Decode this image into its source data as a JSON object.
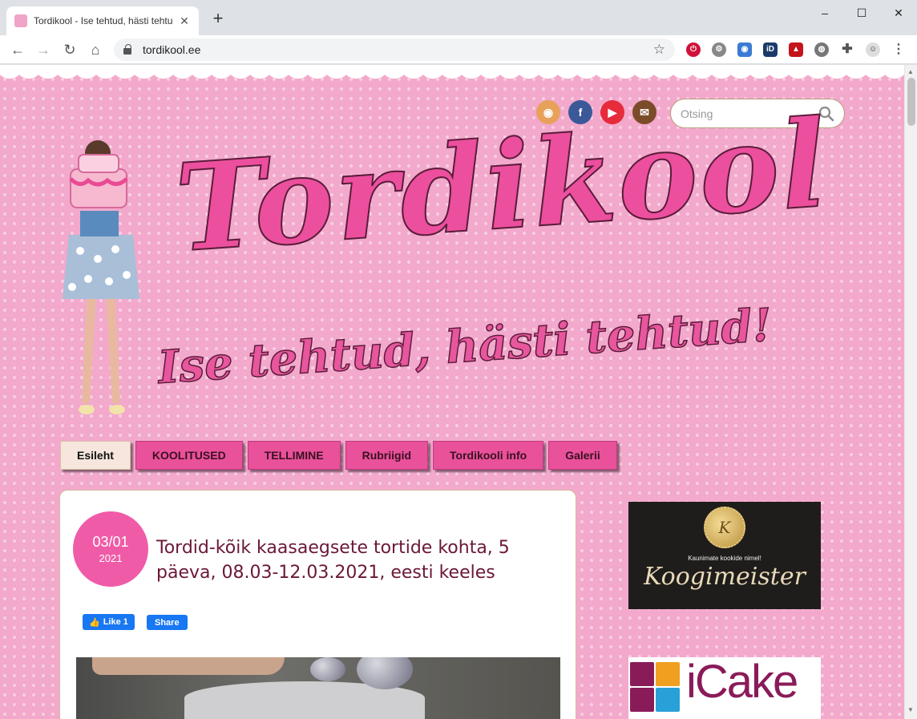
{
  "browser": {
    "tab_title": "Tordikool - Ise tehtud, hästi tehtud!",
    "url": "tordikool.ee",
    "window_controls": {
      "minimize": "–",
      "maximize": "☐",
      "close": "✕"
    },
    "nav": {
      "back": "←",
      "forward": "→",
      "reload": "↻",
      "home": "⌂"
    },
    "extensions": [
      "power-icon",
      "settings-ext-icon",
      "camera-icon",
      "id-icon",
      "pdf-icon",
      "globe-icon",
      "puzzle-icon",
      "profile-icon"
    ]
  },
  "header": {
    "social": [
      {
        "name": "rss",
        "glyph": "◉",
        "color": "#e8a15a"
      },
      {
        "name": "facebook",
        "glyph": "f",
        "color": "#3b5998"
      },
      {
        "name": "youtube",
        "glyph": "▶",
        "color": "#e62b3a"
      },
      {
        "name": "email",
        "glyph": "✉",
        "color": "#7a4c2a"
      }
    ],
    "search_placeholder": "Otsing",
    "logo_title": "Tordikool",
    "logo_subtitle": "Ise tehtud, hästi tehtud!"
  },
  "nav": {
    "items": [
      {
        "label": "Esileht",
        "active": true
      },
      {
        "label": "KOOLITUSED",
        "active": false
      },
      {
        "label": "TELLIMINE",
        "active": false
      },
      {
        "label": "Rubriigid",
        "active": false
      },
      {
        "label": "Tordikooli info",
        "active": false
      },
      {
        "label": "Galerii",
        "active": false
      }
    ]
  },
  "post": {
    "date_day": "03/01",
    "date_year": "2021",
    "title": "Tordid-kõik kaasaegsete tortide kohta, 5 päeva, 08.03-12.03.2021, eesti keeles",
    "fb_like": "Like 1",
    "fb_share": "Share"
  },
  "sidebar": {
    "ad1_tagline": "Kaunimate kookide nimel!",
    "ad1_name": "Koogimeister",
    "ad1_monogram": "K",
    "ad2_name": "iCake",
    "ad2_tile_colors": [
      "#8a1b59",
      "#f0a020",
      "#8a1b59",
      "#2aa0d8"
    ]
  }
}
